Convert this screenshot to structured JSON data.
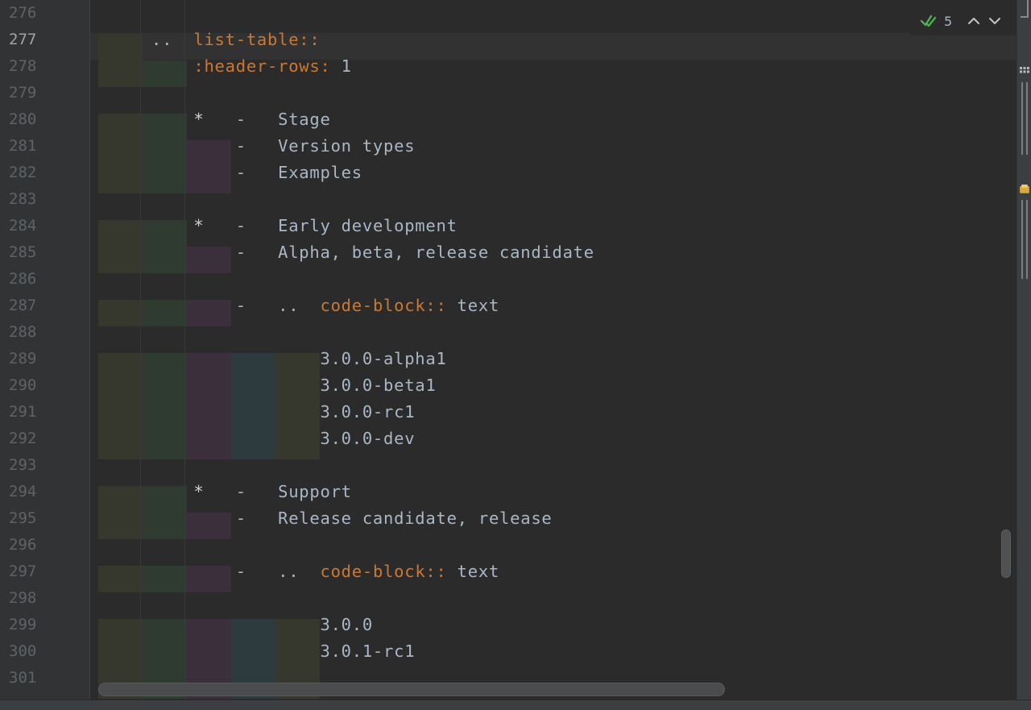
{
  "editor": {
    "current_line": "277",
    "lines": [
      {
        "num": "276",
        "segments": []
      },
      {
        "num": "277",
        "segments": [
          {
            "text": "..  ",
            "cls": "tok-plain"
          },
          {
            "text": "list-table::",
            "cls": "tok-kw"
          }
        ]
      },
      {
        "num": "278",
        "segments": [
          {
            "text": "    ",
            "cls": "tok-plain"
          },
          {
            "text": ":header-rows:",
            "cls": "tok-kw"
          },
          {
            "text": " 1",
            "cls": "tok-plain"
          }
        ]
      },
      {
        "num": "279",
        "segments": []
      },
      {
        "num": "280",
        "segments": [
          {
            "text": "    ",
            "cls": "tok-plain"
          },
          {
            "text": "*",
            "cls": "tok-bullet"
          },
          {
            "text": "   -   Stage",
            "cls": "tok-plain"
          }
        ]
      },
      {
        "num": "281",
        "segments": [
          {
            "text": "        -   Version types",
            "cls": "tok-plain"
          }
        ]
      },
      {
        "num": "282",
        "segments": [
          {
            "text": "        -   Examples",
            "cls": "tok-plain"
          }
        ]
      },
      {
        "num": "283",
        "segments": []
      },
      {
        "num": "284",
        "segments": [
          {
            "text": "    ",
            "cls": "tok-plain"
          },
          {
            "text": "*",
            "cls": "tok-bullet"
          },
          {
            "text": "   -   Early development",
            "cls": "tok-plain"
          }
        ]
      },
      {
        "num": "285",
        "segments": [
          {
            "text": "        -   Alpha, beta, release candidate",
            "cls": "tok-plain"
          }
        ]
      },
      {
        "num": "286",
        "segments": []
      },
      {
        "num": "287",
        "segments": [
          {
            "text": "        -   ..  ",
            "cls": "tok-plain"
          },
          {
            "text": "code-block::",
            "cls": "tok-kw"
          },
          {
            "text": " text",
            "cls": "tok-plain"
          }
        ]
      },
      {
        "num": "288",
        "segments": []
      },
      {
        "num": "289",
        "segments": [
          {
            "text": "                3.0.0-alpha1",
            "cls": "tok-plain"
          }
        ]
      },
      {
        "num": "290",
        "segments": [
          {
            "text": "                3.0.0-beta1",
            "cls": "tok-plain"
          }
        ]
      },
      {
        "num": "291",
        "segments": [
          {
            "text": "                3.0.0-rc1",
            "cls": "tok-plain"
          }
        ]
      },
      {
        "num": "292",
        "segments": [
          {
            "text": "                3.0.0-dev",
            "cls": "tok-plain"
          }
        ]
      },
      {
        "num": "293",
        "segments": []
      },
      {
        "num": "294",
        "segments": [
          {
            "text": "    ",
            "cls": "tok-plain"
          },
          {
            "text": "*",
            "cls": "tok-bullet"
          },
          {
            "text": "   -   Support",
            "cls": "tok-plain"
          }
        ]
      },
      {
        "num": "295",
        "segments": [
          {
            "text": "        -   Release candidate, release",
            "cls": "tok-plain"
          }
        ]
      },
      {
        "num": "296",
        "segments": []
      },
      {
        "num": "297",
        "segments": [
          {
            "text": "        -   ..  ",
            "cls": "tok-plain"
          },
          {
            "text": "code-block::",
            "cls": "tok-kw"
          },
          {
            "text": " text",
            "cls": "tok-plain"
          }
        ]
      },
      {
        "num": "298",
        "segments": []
      },
      {
        "num": "299",
        "segments": [
          {
            "text": "                3.0.0",
            "cls": "tok-plain"
          }
        ]
      },
      {
        "num": "300",
        "segments": [
          {
            "text": "                3.0.1-rc1",
            "cls": "tok-plain"
          }
        ]
      },
      {
        "num": "301",
        "segments": []
      }
    ]
  },
  "inspection_widget": {
    "count": "5",
    "status_icon": "double-check-icon",
    "prev_icon": "chevron-up-icon",
    "next_icon": "chevron-down-icon",
    "status_color": "#4caf50"
  },
  "indent_rainbow_colors": [
    "#36372d",
    "#2f3a30",
    "#3b2f3b",
    "#2e3b3e"
  ],
  "theme": {
    "keyword_color": "#cc7832",
    "text_color": "#a9b7c6",
    "background": "#2b2b2b",
    "gutter_background": "#313335"
  }
}
